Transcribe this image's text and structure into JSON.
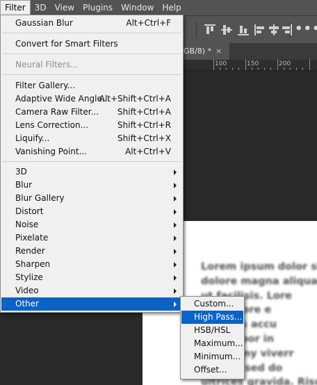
{
  "menubar": {
    "items": [
      "Filter",
      "3D",
      "View",
      "Plugins",
      "Window",
      "Help"
    ],
    "active_index": 0
  },
  "document_tab": {
    "label": "GB/8) *",
    "close": "×"
  },
  "ruler": {
    "labels": [
      "100",
      "150",
      "200"
    ]
  },
  "document_text": [
    "Lorem ipsum dolor sit",
    "dolore magna aliqua.",
    "ut facilisis. Lore",
    "t ut labore e",
    "aecenas accu",
    "od tempor in",
    "nonummy viverr",
    "ng elit, sed do",
    "ultrices gravida. Risus"
  ],
  "filter_menu": {
    "items": [
      {
        "label": "Gaussian Blur",
        "shortcut": "Alt+Ctrl+F"
      },
      {
        "label": "Convert for Smart Filters",
        "shortcut": ""
      },
      {
        "label": "Neural Filters...",
        "shortcut": "",
        "disabled": true
      },
      {
        "label": "Filter Gallery...",
        "shortcut": ""
      },
      {
        "label": "Adaptive Wide Angle...",
        "shortcut": "Alt+Shift+Ctrl+A"
      },
      {
        "label": "Camera Raw Filter...",
        "shortcut": "Shift+Ctrl+A"
      },
      {
        "label": "Lens Correction...",
        "shortcut": "Shift+Ctrl+R"
      },
      {
        "label": "Liquify...",
        "shortcut": "Shift+Ctrl+X"
      },
      {
        "label": "Vanishing Point...",
        "shortcut": "Alt+Ctrl+V"
      },
      {
        "label": "3D",
        "submenu": true
      },
      {
        "label": "Blur",
        "submenu": true
      },
      {
        "label": "Blur Gallery",
        "submenu": true
      },
      {
        "label": "Distort",
        "submenu": true
      },
      {
        "label": "Noise",
        "submenu": true
      },
      {
        "label": "Pixelate",
        "submenu": true
      },
      {
        "label": "Render",
        "submenu": true
      },
      {
        "label": "Sharpen",
        "submenu": true
      },
      {
        "label": "Stylize",
        "submenu": true
      },
      {
        "label": "Video",
        "submenu": true
      },
      {
        "label": "Other",
        "submenu": true,
        "selected": true
      }
    ]
  },
  "other_submenu": {
    "items": [
      {
        "label": "Custom..."
      },
      {
        "label": "High Pass...",
        "selected": true
      },
      {
        "label": "HSB/HSL"
      },
      {
        "label": "Maximum..."
      },
      {
        "label": "Minimum..."
      },
      {
        "label": "Offset..."
      }
    ]
  },
  "colors": {
    "highlight": "#0a64c8",
    "menu_bg": "#f0f0f0",
    "chrome": "#535353"
  },
  "icons": [
    "align-top-icon",
    "align-vertical-center-icon",
    "align-bottom-icon",
    "align-left-icon",
    "align-horizontal-center-icon",
    "align-right-icon",
    "more-options-icon"
  ]
}
